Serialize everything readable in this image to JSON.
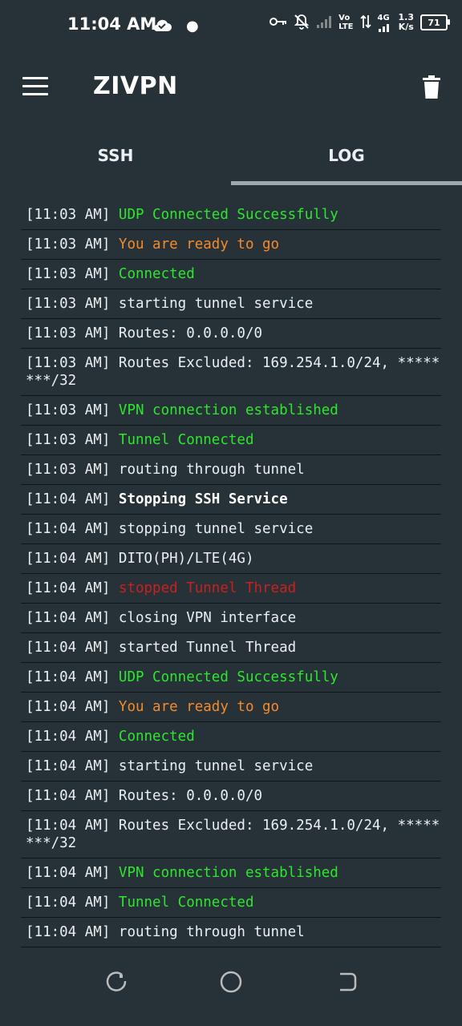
{
  "status_bar": {
    "time": "11:04 AM",
    "network_speed_value": "1.3",
    "network_speed_unit": "K/s",
    "volte_top": "Vo",
    "volte_bottom": "LTE",
    "network_type": "4G",
    "battery": "71"
  },
  "toolbar": {
    "title": "ZIVPN"
  },
  "tabs": [
    {
      "label": "SSH",
      "selected": false
    },
    {
      "label": "LOG",
      "selected": true
    }
  ],
  "log": [
    {
      "time": "[11:03 AM]",
      "message": "UDP Connected Successfully",
      "style": "green"
    },
    {
      "time": "[11:03 AM]",
      "message": "You are ready to go",
      "style": "orange"
    },
    {
      "time": "[11:03 AM]",
      "message": "Connected",
      "style": "green"
    },
    {
      "time": "[11:03 AM]",
      "message": "starting tunnel service",
      "style": "normal"
    },
    {
      "time": "[11:03 AM]",
      "message": "Routes: 0.0.0.0/0",
      "style": "normal"
    },
    {
      "time": "[11:03 AM]",
      "message": "Routes Excluded: 169.254.1.0/24, ********/32",
      "style": "normal"
    },
    {
      "time": "[11:03 AM]",
      "message": "VPN connection established",
      "style": "green"
    },
    {
      "time": "[11:03 AM]",
      "message": "Tunnel Connected",
      "style": "green"
    },
    {
      "time": "[11:03 AM]",
      "message": "routing through tunnel",
      "style": "normal"
    },
    {
      "time": "[11:04 AM]",
      "message": "Stopping SSH Service",
      "style": "bold"
    },
    {
      "time": "[11:04 AM]",
      "message": "stopping tunnel service",
      "style": "normal"
    },
    {
      "time": "[11:04 AM]",
      "message": "DITO(PH)/LTE(4G)",
      "style": "normal"
    },
    {
      "time": "[11:04 AM]",
      "message": "stopped Tunnel Thread",
      "style": "red"
    },
    {
      "time": "[11:04 AM]",
      "message": "closing VPN interface",
      "style": "normal"
    },
    {
      "time": "[11:04 AM]",
      "message": "started Tunnel Thread",
      "style": "normal"
    },
    {
      "time": "[11:04 AM]",
      "message": "UDP Connected Successfully",
      "style": "green"
    },
    {
      "time": "[11:04 AM]",
      "message": "You are ready to go",
      "style": "orange"
    },
    {
      "time": "[11:04 AM]",
      "message": "Connected",
      "style": "green"
    },
    {
      "time": "[11:04 AM]",
      "message": "starting tunnel service",
      "style": "normal"
    },
    {
      "time": "[11:04 AM]",
      "message": "Routes: 0.0.0.0/0",
      "style": "normal"
    },
    {
      "time": "[11:04 AM]",
      "message": "Routes Excluded: 169.254.1.0/24, ********/32",
      "style": "normal"
    },
    {
      "time": "[11:04 AM]",
      "message": "VPN connection established",
      "style": "green"
    },
    {
      "time": "[11:04 AM]",
      "message": "Tunnel Connected",
      "style": "green"
    },
    {
      "time": "[11:04 AM]",
      "message": "routing through tunnel",
      "style": "normal"
    }
  ],
  "icons": {
    "menu": "hamburger-menu-icon",
    "clear": "trash-icon",
    "nav_recent": "recent-apps-icon",
    "nav_home": "home-icon",
    "nav_back": "back-icon"
  },
  "colors": {
    "background": "#263238",
    "green": "#2ee62e",
    "orange": "#f58a2a",
    "red": "#cc1f1f"
  }
}
